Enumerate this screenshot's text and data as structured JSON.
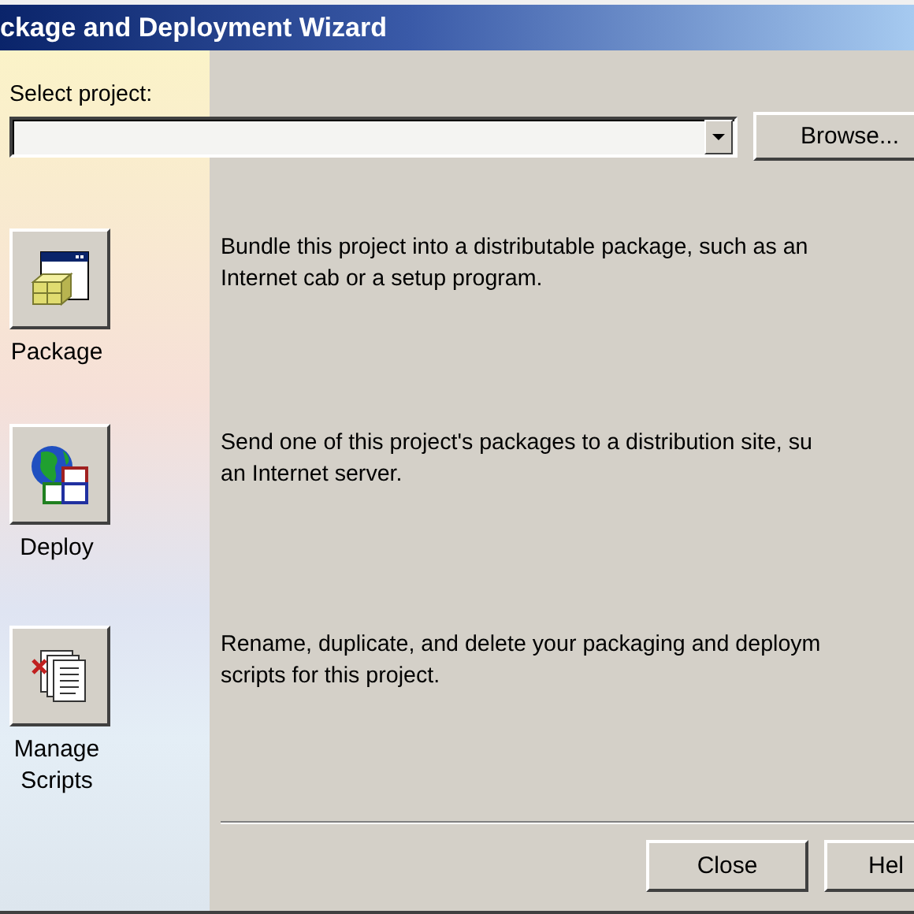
{
  "window": {
    "title": "ckage and Deployment Wizard"
  },
  "project": {
    "label": "Select project:",
    "browse_button": "Browse..."
  },
  "options": [
    {
      "kind": "package",
      "label": "Package",
      "description": [
        "Bundle this project into a distributable package, such as an",
        "Internet cab or a setup program."
      ]
    },
    {
      "kind": "deploy",
      "label": "Deploy",
      "description": [
        "Send one of this project's packages to a distribution site, su",
        "an Internet server."
      ]
    },
    {
      "kind": "scripts",
      "label": "Manage Scripts",
      "description": [
        "Rename, duplicate, and delete your packaging and deploym",
        "scripts for this project."
      ]
    }
  ],
  "buttons": [
    "Close",
    "Hel"
  ]
}
